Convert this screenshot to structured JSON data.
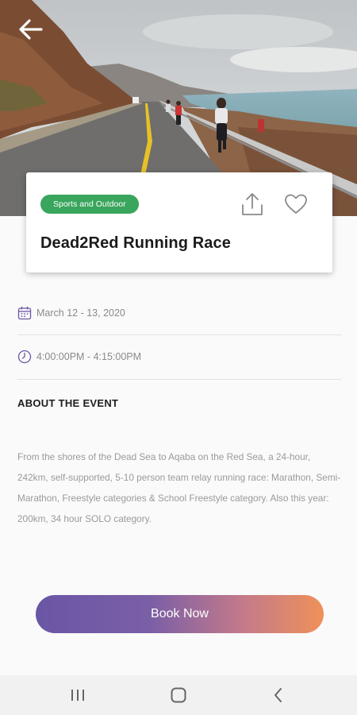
{
  "hero": {
    "image": "road-along-dead-sea-runners-photo",
    "back_icon": "arrow-left-icon"
  },
  "card": {
    "category": "Sports and Outdoor",
    "category_color": "#3aa55c",
    "title": "Dead2Red Running Race",
    "share_icon": "share-icon",
    "favorite_icon": "heart-icon"
  },
  "details": {
    "date": "March 12 - 13, 2020",
    "date_icon": "calendar-icon",
    "time": "4:00:00PM - 4:15:00PM",
    "time_icon": "clock-icon"
  },
  "about": {
    "heading": "ABOUT THE EVENT",
    "text": "From the shores of the Dead Sea to Aqaba on the Red Sea, a 24-hour, 242km, self-supported, 5-10 person team relay running race: Marathon, Semi-Marathon, Freestyle categories & School Freestyle category. Also this year: 200km, 34 hour SOLO category."
  },
  "action": {
    "book_label": "Book Now",
    "gradient_start": "#6a56a6",
    "gradient_end": "#ef9159"
  },
  "system_nav": {
    "recents_icon": "recents-icon",
    "home_icon": "home-icon",
    "back_icon": "nav-back-icon"
  }
}
